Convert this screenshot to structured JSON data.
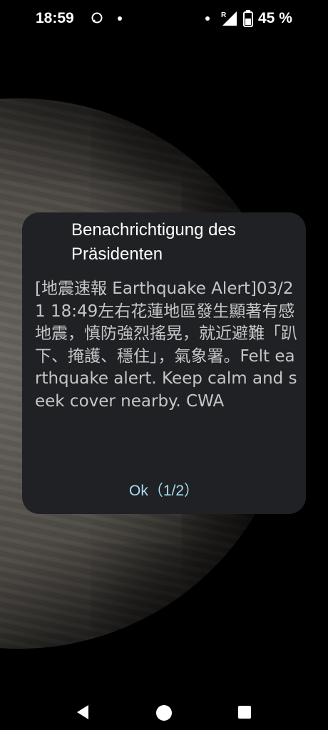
{
  "statusbar": {
    "time": "18:59",
    "battery": "45 %",
    "roaming": "R"
  },
  "dialog": {
    "title": "Benachrichtigung des Präsidenten",
    "body": "[地震速報 Earthquake Alert]03/21 18:49左右花蓮地區發生顯著有感地震，慎防強烈搖晃，就近避難「趴下、掩護、穩住」，氣象署。Felt earthquake alert. Keep calm and seek cover nearby. CWA",
    "ok_label": "Ok（1/2）"
  },
  "colors": {
    "dialog_bg": "#202124",
    "title": "#ffffff",
    "body": "#c6c6c6",
    "accent": "#a8dcf4"
  },
  "icons": [
    "message-icon",
    "signal-icon",
    "battery-icon",
    "back-icon",
    "home-icon",
    "recents-icon"
  ]
}
